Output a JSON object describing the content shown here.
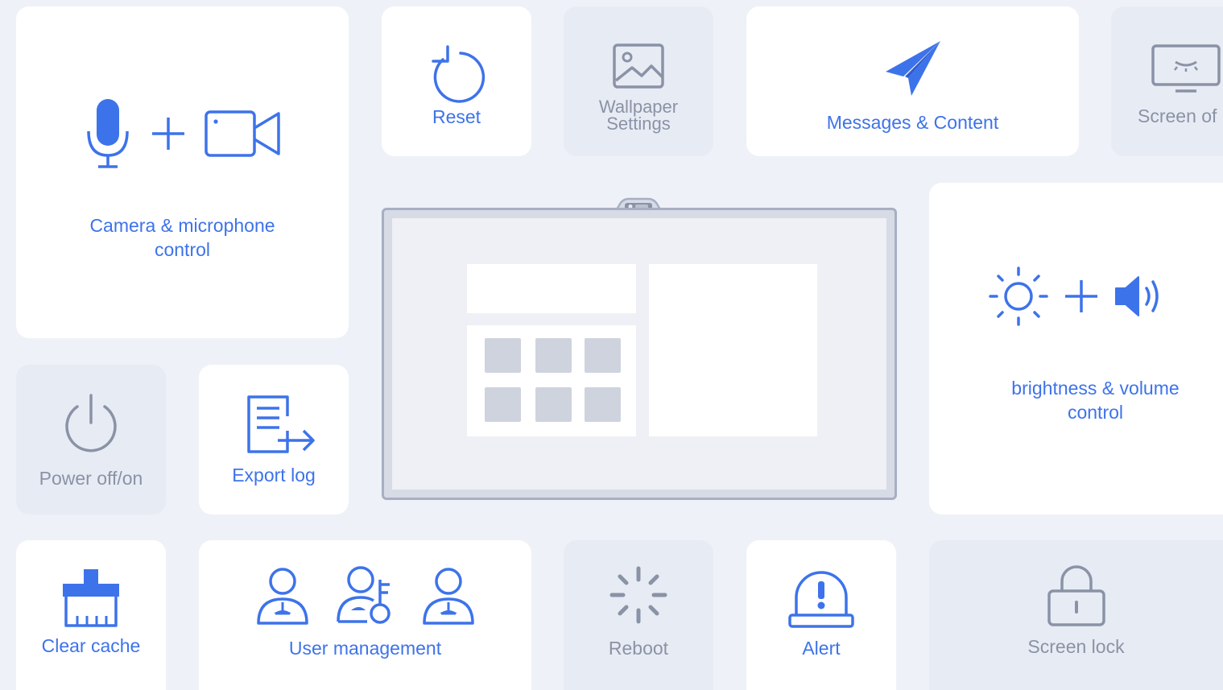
{
  "tiles": {
    "camera_mic": {
      "label": "Camera & microphone control",
      "icons": [
        "microphone-icon",
        "plus-icon",
        "video-camera-icon"
      ],
      "state": "active"
    },
    "reset": {
      "label": "Reset",
      "icon": "reset-icon",
      "state": "active"
    },
    "wallpaper": {
      "label_line1": "Wallpaper",
      "label_line2": "Settings",
      "icon": "image-icon",
      "state": "inactive"
    },
    "messages": {
      "label": "Messages & Content",
      "icon": "send-icon",
      "state": "active"
    },
    "screen_off": {
      "label": "Screen of",
      "icon": "monitor-sleep-icon",
      "state": "inactive"
    },
    "brightness_volume": {
      "label": "brightness & volume control",
      "icons": [
        "brightness-icon",
        "plus-icon",
        "volume-icon"
      ],
      "state": "active"
    },
    "power": {
      "label": "Power off/on",
      "icon": "power-icon",
      "state": "inactive"
    },
    "export_log": {
      "label": "Export log",
      "icon": "export-document-icon",
      "state": "active"
    },
    "clear_cache": {
      "label": "Clear cache",
      "icon": "broom-icon",
      "state": "active"
    },
    "user_management": {
      "label": "User management",
      "icons": [
        "user-icon",
        "user-key-icon",
        "user-icon"
      ],
      "state": "active"
    },
    "reboot": {
      "label": "Reboot",
      "icon": "loading-spinner-icon",
      "state": "inactive"
    },
    "alert": {
      "label": "Alert",
      "icon": "alarm-light-icon",
      "state": "active"
    },
    "screen_lock": {
      "label": "Screen lock",
      "icon": "lock-icon",
      "state": "inactive"
    }
  },
  "colors": {
    "background": "#eef1f7",
    "active_tile": "#ffffff",
    "inactive_tile": "#e7ebf4",
    "accent_blue": "#3d73ea",
    "inactive_text": "#8a93a6",
    "display_frame": "#a7afc3"
  },
  "display": {
    "icon": "interactive-display-icon",
    "camera": "webcam-icon"
  }
}
